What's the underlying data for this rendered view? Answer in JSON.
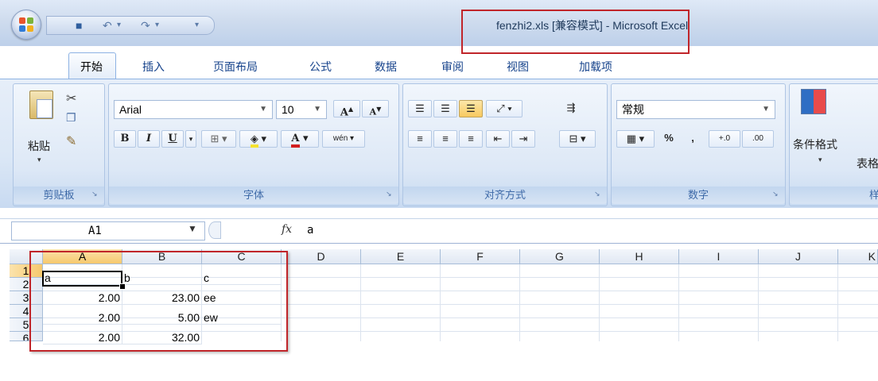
{
  "window": {
    "title": "fenzhi2.xls  [兼容模式] - Microsoft Excel"
  },
  "tabs": [
    {
      "label": "开始",
      "active": true
    },
    {
      "label": "插入"
    },
    {
      "label": "页面布局"
    },
    {
      "label": "公式"
    },
    {
      "label": "数据"
    },
    {
      "label": "审阅"
    },
    {
      "label": "视图"
    },
    {
      "label": "加载项"
    }
  ],
  "ribbon": {
    "clipboard": {
      "paste_label": "粘贴",
      "group_label": "剪贴板"
    },
    "font": {
      "font_name": "Arial",
      "font_size": "10",
      "group_label": "字体",
      "bold": "B",
      "italic": "I",
      "underline": "U",
      "font_color": "A",
      "phonetic": "wén"
    },
    "alignment": {
      "group_label": "对齐方式"
    },
    "number": {
      "format": "常规",
      "group_label": "数字",
      "percent": "%",
      "comma": ",",
      "inc_decimal": "+.0",
      "dec_decimal": ".00"
    },
    "styles": {
      "conditional_format": "条件格式",
      "format_table_partial": "表格",
      "group_label_partial": "样"
    }
  },
  "formula_bar": {
    "name_box": "A1",
    "fx": "fx",
    "value": "a"
  },
  "grid": {
    "columns": [
      "A",
      "B",
      "C",
      "D",
      "E",
      "F",
      "G",
      "H",
      "I",
      "J",
      "K"
    ],
    "rows": [
      "1",
      "2",
      "3",
      "4",
      "5",
      "6"
    ],
    "cells": {
      "A1": "a",
      "B1": "b",
      "C1": "c",
      "A2": "2.00",
      "B2": "23.00",
      "C2": "ee",
      "A3": "2.00",
      "B3": "5.00",
      "C3": "ew",
      "A4": "2.00",
      "B4": "32.00"
    },
    "active_cell": "A1"
  },
  "colors": {
    "highlight_red": "#c0252a",
    "ribbon_text": "#15428b",
    "selected_header": "#f6c86d"
  }
}
